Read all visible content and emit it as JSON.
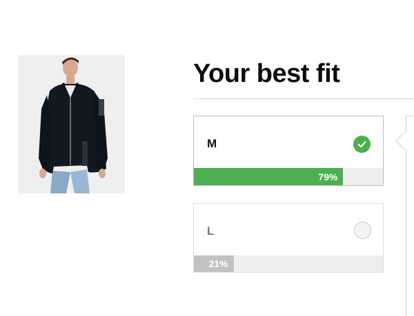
{
  "product": {
    "image_alt": "man wearing dark bomber jacket"
  },
  "title": "Your best fit",
  "sizes": [
    {
      "label": "M",
      "percent_text": "79%",
      "fit_fraction": 0.79,
      "selected": true
    },
    {
      "label": "L",
      "percent_text": "21%",
      "fit_fraction": 0.21,
      "selected": false
    }
  ],
  "colors": {
    "accent": "#4caf50",
    "bar_grey": "#c2c2c2",
    "bar_track": "#efeeec"
  },
  "icons": {
    "selected": "check-icon",
    "unselected": "radio-empty-icon"
  }
}
